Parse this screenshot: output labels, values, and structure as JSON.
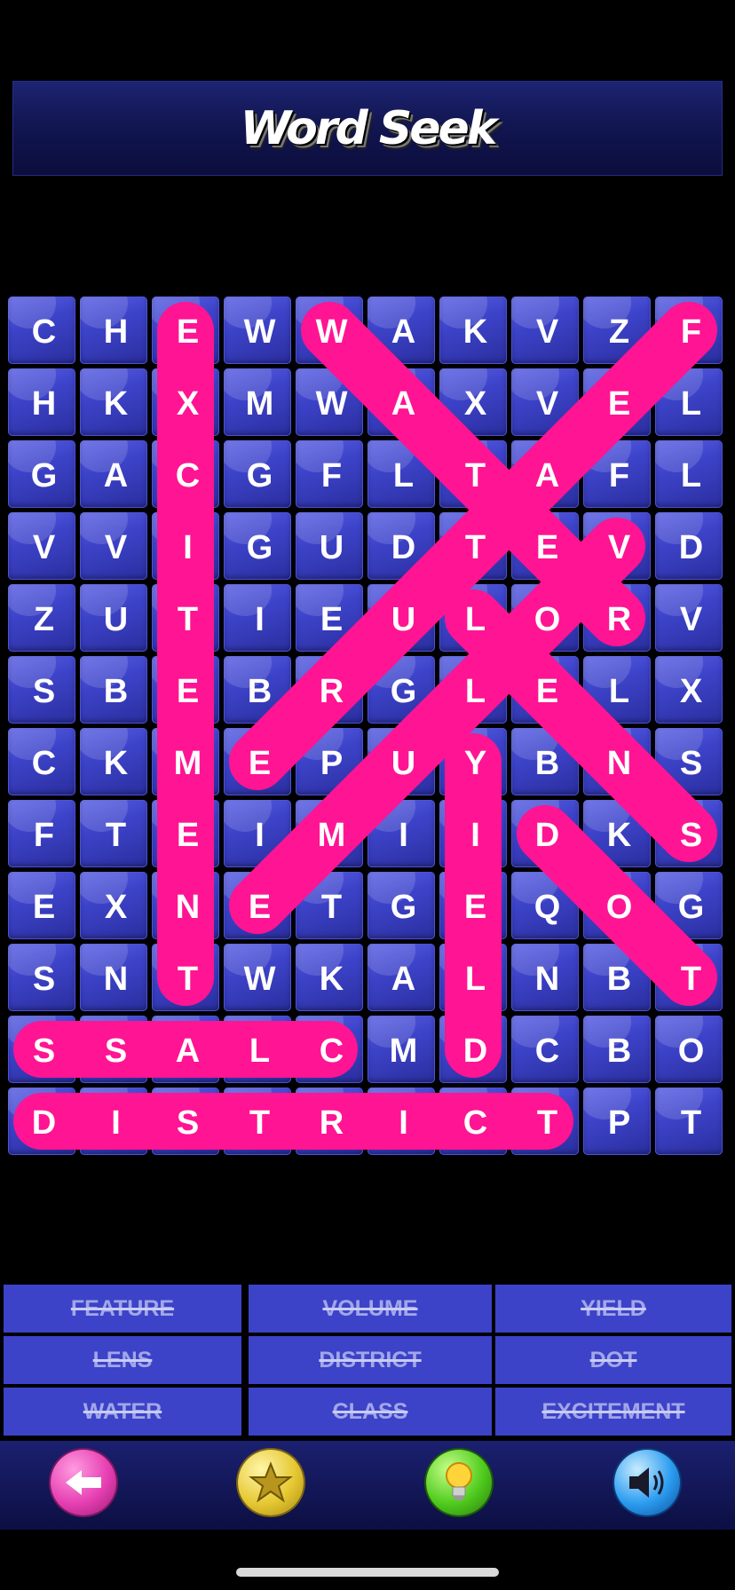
{
  "app": {
    "title": "Word Seek"
  },
  "grid": [
    [
      "C",
      "H",
      "E",
      "W",
      "W",
      "A",
      "K",
      "V",
      "Z",
      "F"
    ],
    [
      "H",
      "K",
      "X",
      "M",
      "W",
      "A",
      "X",
      "V",
      "E",
      "L"
    ],
    [
      "G",
      "A",
      "C",
      "G",
      "F",
      "L",
      "T",
      "A",
      "F",
      "L"
    ],
    [
      "V",
      "V",
      "I",
      "G",
      "U",
      "D",
      "T",
      "E",
      "V",
      "D"
    ],
    [
      "Z",
      "U",
      "T",
      "I",
      "E",
      "U",
      "L",
      "O",
      "R",
      "V"
    ],
    [
      "S",
      "B",
      "E",
      "B",
      "R",
      "G",
      "L",
      "E",
      "L",
      "X"
    ],
    [
      "C",
      "K",
      "M",
      "E",
      "P",
      "U",
      "Y",
      "B",
      "N",
      "S"
    ],
    [
      "F",
      "T",
      "E",
      "I",
      "M",
      "I",
      "I",
      "D",
      "K",
      "S"
    ],
    [
      "E",
      "X",
      "N",
      "E",
      "T",
      "G",
      "E",
      "Q",
      "O",
      "G"
    ],
    [
      "S",
      "N",
      "T",
      "W",
      "K",
      "A",
      "L",
      "N",
      "B",
      "T"
    ],
    [
      "S",
      "S",
      "A",
      "L",
      "C",
      "M",
      "D",
      "C",
      "B",
      "O"
    ],
    [
      "D",
      "I",
      "S",
      "T",
      "R",
      "I",
      "C",
      "T",
      "P",
      "T"
    ]
  ],
  "found_paths": [
    {
      "word": "EXCITEMENT",
      "from": [
        0,
        2
      ],
      "to": [
        9,
        2
      ]
    },
    {
      "word": "WATER",
      "from": [
        0,
        4
      ],
      "to": [
        4,
        8
      ]
    },
    {
      "word": "FEATURE",
      "from": [
        0,
        9
      ],
      "to": [
        6,
        3
      ]
    },
    {
      "word": "VOLUME",
      "from": [
        3,
        8
      ],
      "to": [
        8,
        3
      ]
    },
    {
      "word": "LENS",
      "from": [
        4,
        6
      ],
      "to": [
        7,
        9
      ]
    },
    {
      "word": "YIELD",
      "from": [
        6,
        6
      ],
      "to": [
        10,
        6
      ]
    },
    {
      "word": "DOT",
      "from": [
        7,
        7
      ],
      "to": [
        9,
        9
      ]
    },
    {
      "word": "CLASS",
      "from": [
        10,
        4
      ],
      "to": [
        10,
        0
      ]
    },
    {
      "word": "DISTRICT",
      "from": [
        11,
        0
      ],
      "to": [
        11,
        7
      ]
    }
  ],
  "word_list": [
    {
      "label": "FEATURE",
      "found": true
    },
    {
      "label": "VOLUME",
      "found": true
    },
    {
      "label": "YIELD",
      "found": true
    },
    {
      "label": "LENS",
      "found": true
    },
    {
      "label": "DISTRICT",
      "found": true
    },
    {
      "label": "DOT",
      "found": true
    },
    {
      "label": "WATER",
      "found": true
    },
    {
      "label": "CLASS",
      "found": true
    },
    {
      "label": "EXCITEMENT",
      "found": true
    }
  ],
  "toolbar": [
    {
      "icon": "back-arrow-icon"
    },
    {
      "icon": "star-icon"
    },
    {
      "icon": "lightbulb-hint-icon"
    },
    {
      "icon": "speaker-sound-icon"
    }
  ],
  "colors": {
    "highlight": "#ff1493",
    "cell": "#3d43c9",
    "word_cell": "#3c43c8"
  }
}
